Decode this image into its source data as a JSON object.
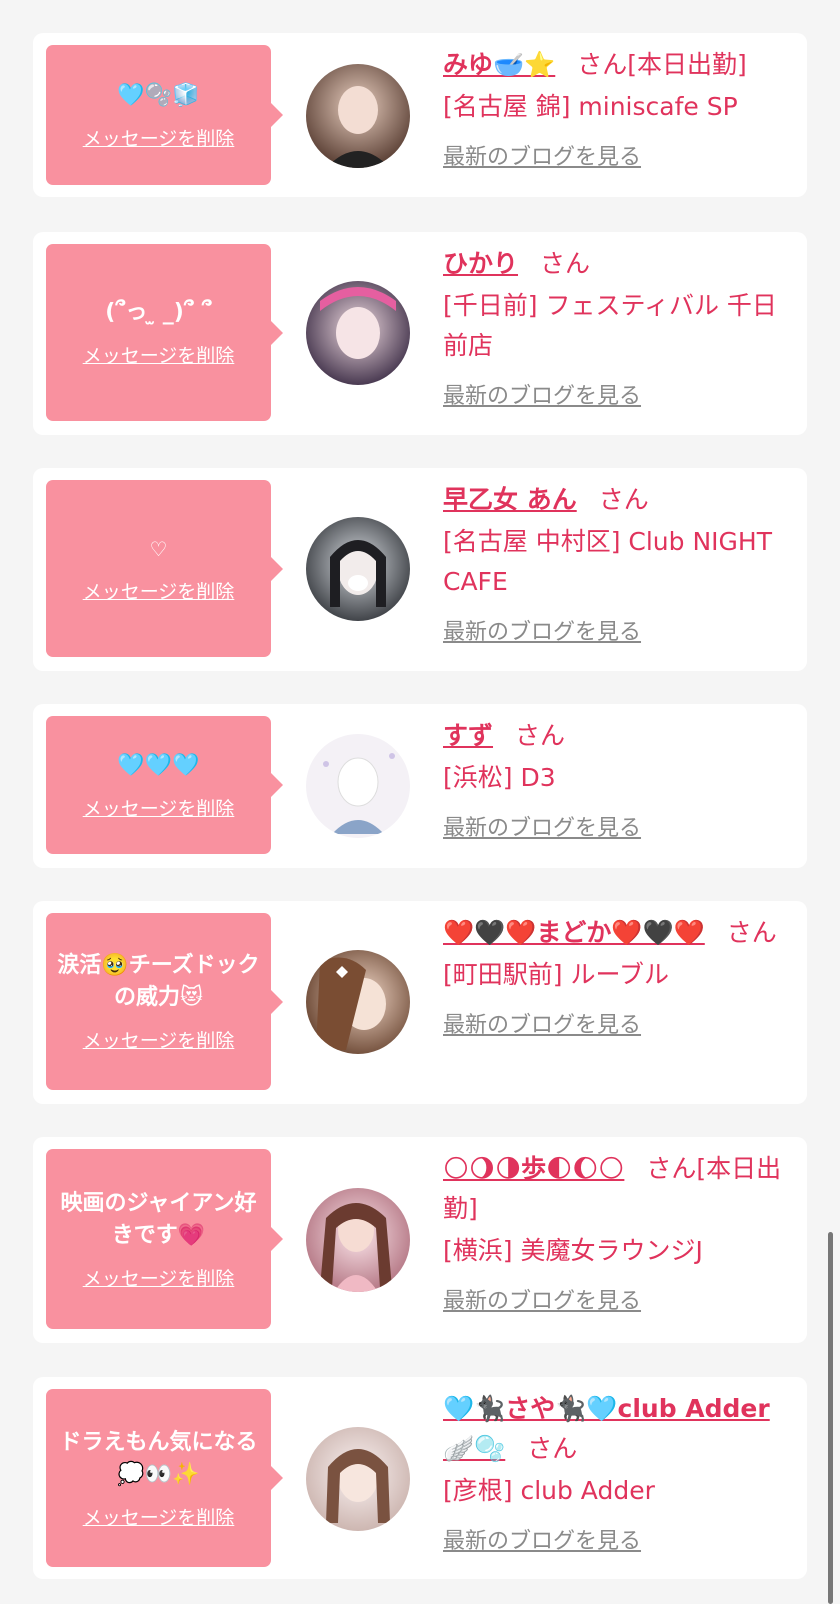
{
  "items": [
    {
      "message": "🩵🫧🧊",
      "delete_label": "メッセージを削除",
      "name": "みゆ🥣⭐",
      "honorific": "さん[本日出勤]",
      "shop": "[名古屋 錦] miniscafe SP",
      "blog_label": "最新のブログを見る"
    },
    {
      "message": "(՞っ ̫ _)՞ ՞",
      "delete_label": "メッセージを削除",
      "name": "ひかり",
      "honorific": "さん",
      "shop": "[千日前] フェスティバル 千日前店",
      "blog_label": "最新のブログを見る"
    },
    {
      "message": "♡",
      "delete_label": "メッセージを削除",
      "name": "早乙女 あん",
      "honorific": "さん",
      "shop": "[名古屋 中村区] Club NIGHT CAFE",
      "blog_label": "最新のブログを見る"
    },
    {
      "message": "🩵🩵🩵",
      "delete_label": "メッセージを削除",
      "name": "すず",
      "honorific": "さん",
      "shop": "[浜松] D3",
      "blog_label": "最新のブログを見る"
    },
    {
      "message": "涙活🥹チーズドックの威力😻",
      "delete_label": "メッセージを削除",
      "name": "❤️🖤❤️まどか❤️🖤❤️",
      "honorific": "さん",
      "shop": "[町田駅前] ルーブル",
      "blog_label": "最新のブログを見る"
    },
    {
      "message": "映画のジャイアン好きです💗",
      "delete_label": "メッセージを削除",
      "name": "🌕🌖🌗歩🌓🌔🌕",
      "honorific": "さん[本日出勤]",
      "shop": "[横浜] 美魔女ラウンジJ",
      "blog_label": "最新のブログを見る"
    },
    {
      "message": "ドラえもん気になる💭👀✨",
      "delete_label": "メッセージを削除",
      "name": "🩵🐈‍⬛さや🐈‍⬛🩵club Adder🪽🫧",
      "honorific": "さん",
      "shop": "[彦根] club Adder",
      "blog_label": "最新のブログを見る"
    }
  ],
  "colors": {
    "accent": "#e0335c",
    "bubble": "#f9919f",
    "link_gray": "#8a8a8a",
    "background": "#f5f5f5"
  }
}
